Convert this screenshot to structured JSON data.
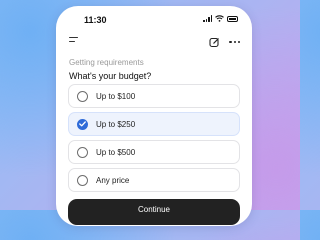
{
  "status_bar": {
    "time": "11:30",
    "icons": [
      "signal-icon",
      "wifi-icon",
      "battery-icon"
    ]
  },
  "toolbar": {
    "icons": [
      "menu-icon",
      "edit-icon",
      "more-icon"
    ]
  },
  "subtitle": "Getting requirements",
  "question": "What's your budget?",
  "options": [
    {
      "label": "Up to $100",
      "selected": false
    },
    {
      "label": "Up to $250",
      "selected": true
    },
    {
      "label": "Up to $500",
      "selected": false
    },
    {
      "label": "Any price",
      "selected": false
    }
  ],
  "continue_label": "Continue",
  "colors": {
    "accent": "#2f6bd8",
    "selected_bg": "#eef3fd",
    "button_bg": "#222222"
  }
}
